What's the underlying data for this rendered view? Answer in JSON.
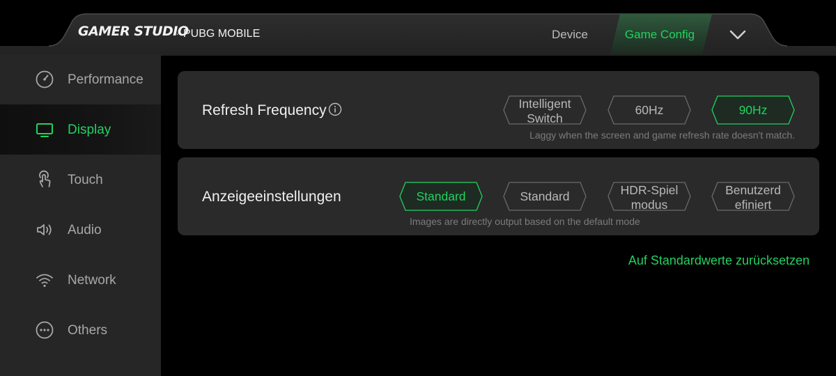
{
  "header": {
    "brand": "GAMER STUDIO",
    "separator": "·",
    "game": "PUBG MOBILE",
    "tabs": [
      {
        "label": "Device",
        "active": false
      },
      {
        "label": "Game Config",
        "active": true
      }
    ]
  },
  "sidebar": {
    "items": [
      {
        "label": "Performance",
        "icon": "gauge-icon",
        "active": false
      },
      {
        "label": "Display",
        "icon": "monitor-icon",
        "active": true
      },
      {
        "label": "Touch",
        "icon": "touch-icon",
        "active": false
      },
      {
        "label": "Audio",
        "icon": "speaker-icon",
        "active": false
      },
      {
        "label": "Network",
        "icon": "wifi-icon",
        "active": false
      },
      {
        "label": "Others",
        "icon": "more-icon",
        "active": false
      }
    ]
  },
  "settings": {
    "refresh": {
      "title": "Refresh Frequency",
      "options": [
        {
          "label": "Intelligent Switch",
          "selected": false
        },
        {
          "label": "60Hz",
          "selected": false
        },
        {
          "label": "90Hz",
          "selected": true
        }
      ],
      "hint": "Laggy when the screen and game refresh rate doesn't match."
    },
    "display": {
      "title": "Anzeigeeinstellungen",
      "options": [
        {
          "label": "Standard",
          "selected": true
        },
        {
          "label": "Standard",
          "selected": false
        },
        {
          "label": "HDR-Spiel modus",
          "selected": false
        },
        {
          "label": "Benutzerd efiniert",
          "selected": false
        }
      ],
      "hint": "Images are directly output based on the default mode"
    }
  },
  "reset_label": "Auf Standardwerte zurücksetzen",
  "colors": {
    "accent": "#23d160",
    "background": "#000000",
    "sidebar": "#262626",
    "card": "#2a2a2a",
    "header": "#262626"
  }
}
